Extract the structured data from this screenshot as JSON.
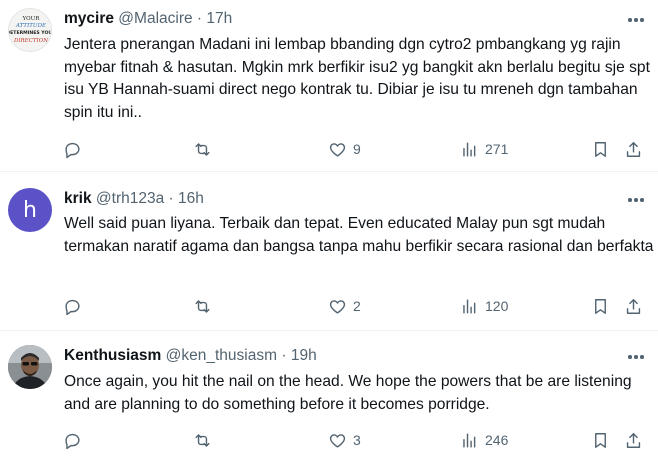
{
  "tweets": [
    {
      "name": "mycire",
      "handle": "@Malacire",
      "dot": "·",
      "time": "17h",
      "avatar_text": "YOUR ATTITUDE DETERMINES YOUR DIRECTION",
      "text": "Jentera pnerangan Madani ini lembap bbanding dgn cytro2 pmbangkang yg rajin myebar fitnah & hasutan. Mgkin mrk berfikir isu2 yg bangkit akn berlalu begitu sje spt isu YB Hannah-suami direct nego kontrak tu. Dibiar je isu tu mreneh dgn tambahan spin itu ini..",
      "likes": "9",
      "views": "271"
    },
    {
      "name": "krik",
      "handle": "@trh123a",
      "dot": "·",
      "time": "16h",
      "avatar_letter": "h",
      "avatar_color": "#5b52c8",
      "text": "Well said puan liyana. Terbaik dan tepat. Even educated Malay pun sgt mudah termakan naratif agama dan bangsa tanpa mahu berfikir secara rasional dan berfakta",
      "likes": "2",
      "views": "120"
    },
    {
      "name": "Kenthusiasm",
      "handle": "@ken_thusiasm",
      "dot": "·",
      "time": "19h",
      "text": "Once again, you hit the nail on the head. We hope the powers that be are listening and are planning to do something before it becomes porridge.",
      "likes": "3",
      "views": "246"
    }
  ],
  "icons": [
    "more-icon",
    "reply-icon",
    "retweet-icon",
    "like-icon",
    "views-icon",
    "bookmark-icon",
    "share-icon"
  ]
}
